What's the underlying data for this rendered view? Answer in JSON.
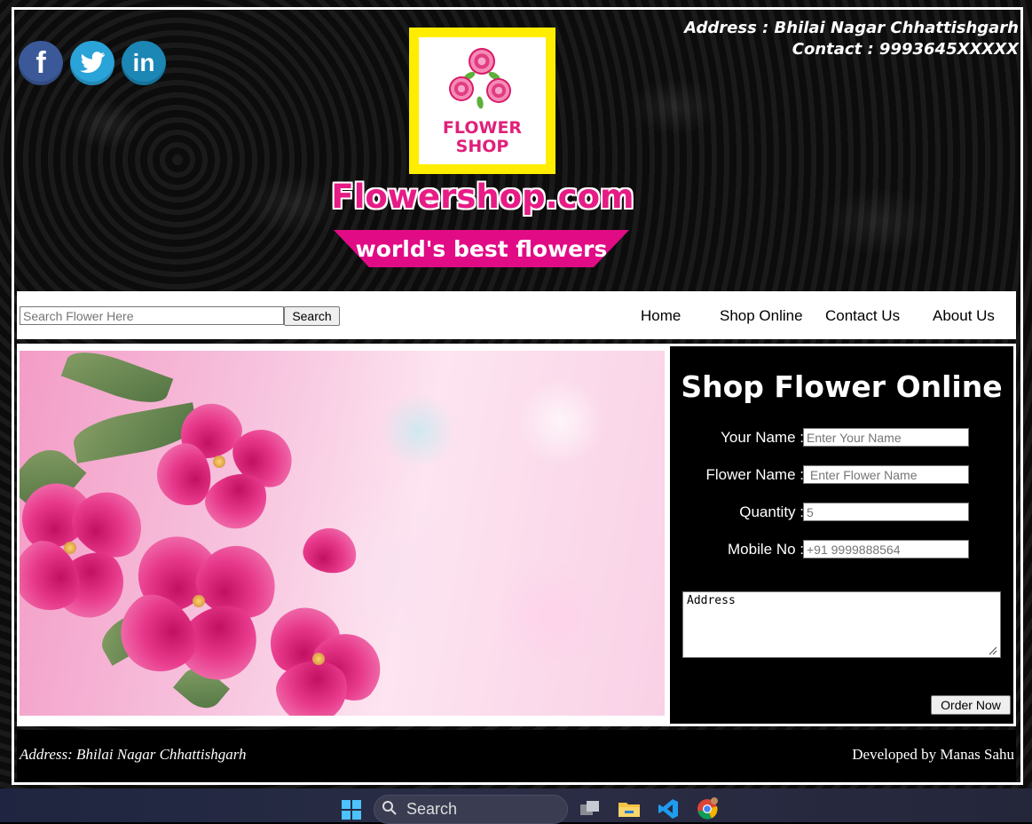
{
  "header": {
    "address": "Address : Bhilai Nagar Chhattishgarh",
    "contact": "Contact : 9993645XXXXX",
    "logo_text": "FLOWER SHOP",
    "site_name": "Flowershop.com",
    "tagline": "world's best flowers",
    "social": [
      {
        "icon": "facebook-icon",
        "glyph": "f"
      },
      {
        "icon": "twitter-icon",
        "glyph": "🐦"
      },
      {
        "icon": "linkedin-icon",
        "glyph": "in"
      }
    ]
  },
  "nav": {
    "search_placeholder": "Search Flower Here",
    "search_button": "Search",
    "links": [
      "Home",
      "Shop Online",
      "Contact Us",
      "About Us"
    ]
  },
  "order_form": {
    "title": "Shop Flower Online",
    "fields": [
      {
        "label": "Your Name :",
        "placeholder": "Enter Your Name"
      },
      {
        "label": "Flower Name :",
        "placeholder": " Enter Flower Name"
      },
      {
        "label": "Quantity :",
        "placeholder": "5"
      },
      {
        "label": "Mobile No :",
        "placeholder": "+91 9999888564"
      }
    ],
    "address_placeholder": "Address",
    "submit": "Order Now"
  },
  "footer": {
    "address": "Address: Bhilai Nagar Chhattishgarh",
    "credit": "Developed by Manas Sahu"
  },
  "taskbar": {
    "search_label": "Search"
  },
  "colors": {
    "brand_pink": "#e61b86",
    "logo_yellow": "#ffed00"
  }
}
